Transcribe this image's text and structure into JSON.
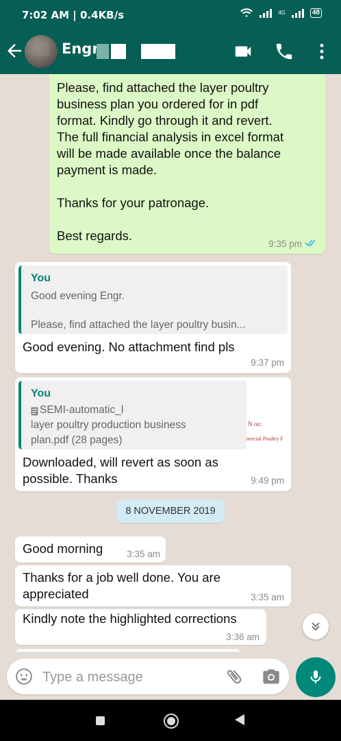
{
  "status": {
    "time": "7:02 AM | 0.4KB/s",
    "network": "4G",
    "battery": "48"
  },
  "header": {
    "contact_name": "Engr",
    "icons": [
      "back-arrow-icon",
      "video-call-icon",
      "voice-call-icon",
      "more-options-icon"
    ]
  },
  "messages": [
    {
      "text": "Please, find attached the layer poultry\nbusiness plan you ordered for in pdf\nformat. Kindly go through it and revert.\nThe full financial analysis in excel format\nwill be made available once the balance\npayment is made.\n\nThanks for your patronage.\n\nBest regards.",
      "time": "9:35 pm"
    },
    {
      "quote_author": "You",
      "quote_line1": "Good evening Engr.",
      "quote_line2": "Please, find attached the layer poultry busin...",
      "text": "Good evening. No attachment find pls",
      "time": "9:37 pm"
    },
    {
      "quote_author": "You",
      "quote_file": "SEMI-automatic_l",
      "quote_file_line2": "layer poultry production business",
      "quote_file_line3": "plan.pdf (28 pages)",
      "thumb_line1": "N on:",
      "thumb_line2": "nercial Poultry F",
      "text": "Downloaded, will revert as soon as\npossible. Thanks",
      "time": "9:49 pm"
    },
    {
      "date_chip": "8 NOVEMBER 2019"
    },
    {
      "text": "Good morning",
      "time": "3:35 am"
    },
    {
      "text": "Thanks for a job well done. You are\nappreciated",
      "time": "3:35 am"
    },
    {
      "text": "Kindly note the highlighted corrections",
      "time": "3:36 am"
    }
  ],
  "input": {
    "placeholder": "Type a message"
  },
  "colors": {
    "header": "#075e54",
    "outgoing": "#dcf8c6",
    "accent": "#00897b",
    "date_chip": "#d2ebf5",
    "read_ticks": "#34b7f1"
  }
}
